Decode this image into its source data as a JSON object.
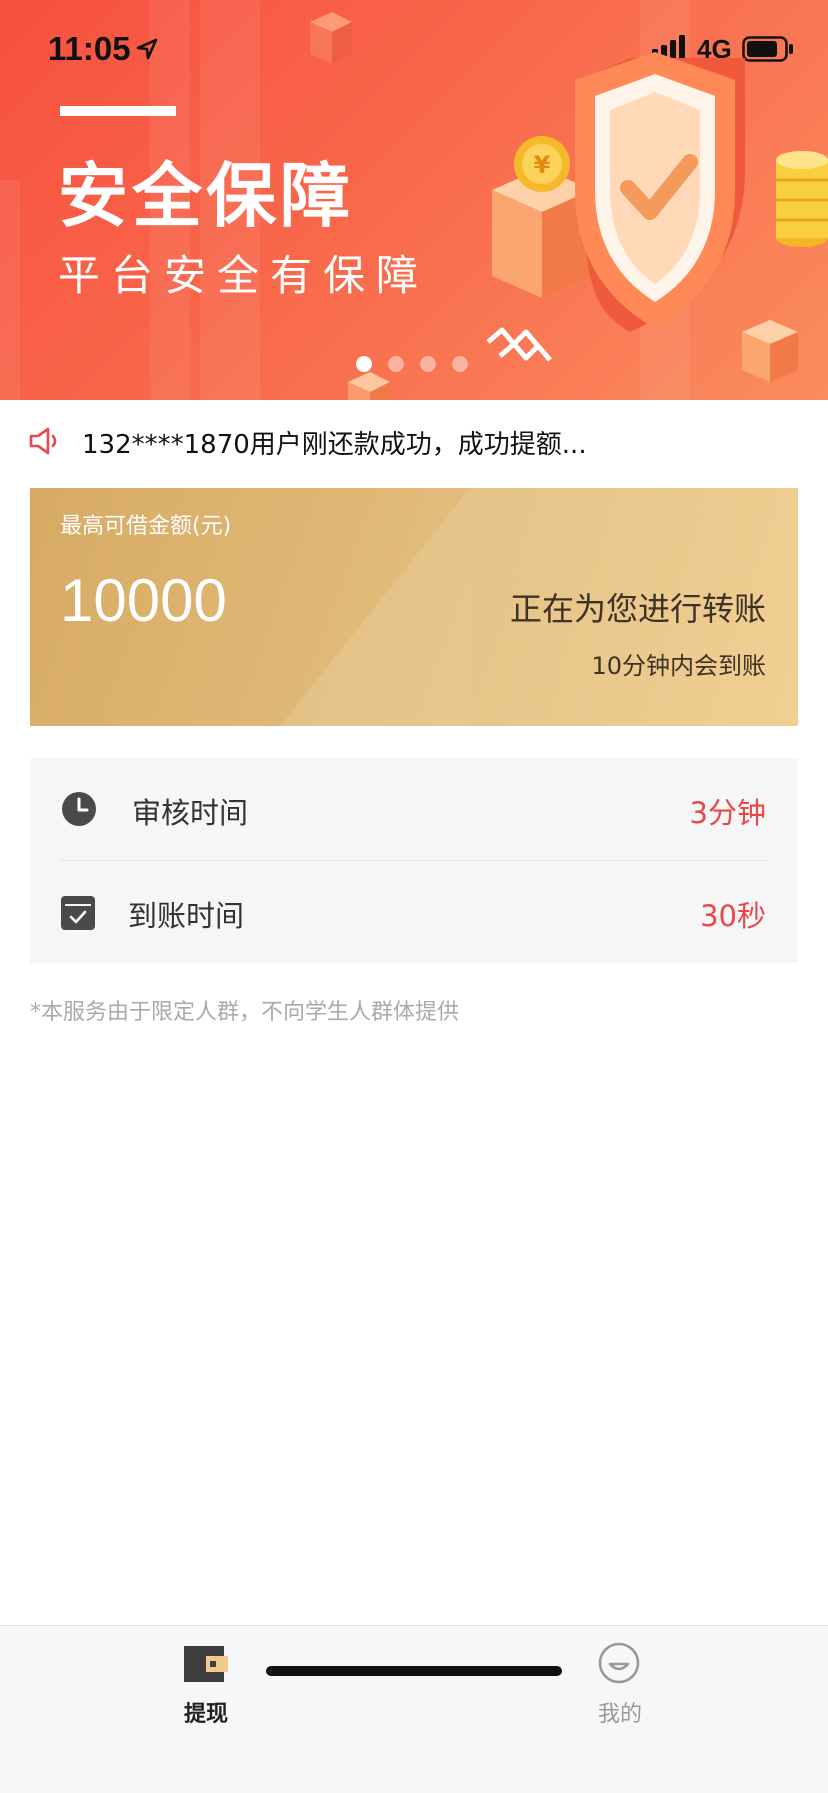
{
  "status_bar": {
    "time": "11:05",
    "network": "4G"
  },
  "banner": {
    "title": "安全保障",
    "subtitle": "平台安全有保障",
    "slide_count": 4,
    "active_slide": 1,
    "colors": {
      "start": "#f7503f",
      "end": "#fb8c5e"
    }
  },
  "notice": {
    "icon": "speaker-icon",
    "text": "132****1870用户刚还款成功，成功提额..."
  },
  "amount_card": {
    "label": "最高可借金额(元)",
    "value": "10000",
    "transfer_title": "正在为您进行转账",
    "transfer_sub": "10分钟内会到账"
  },
  "info": {
    "rows": [
      {
        "icon": "clock-icon",
        "label": "审核时间",
        "value": "3分钟"
      },
      {
        "icon": "checkbox-icon",
        "label": "到账时间",
        "value": "30秒"
      }
    ],
    "value_color": "#e9474a"
  },
  "disclaimer": "*本服务由于限定人群，不向学生人群体提供",
  "tabbar": {
    "tabs": [
      {
        "label": "提现",
        "icon": "wallet-icon",
        "active": true
      },
      {
        "label": "我的",
        "icon": "smile-face-icon",
        "active": false
      }
    ]
  }
}
